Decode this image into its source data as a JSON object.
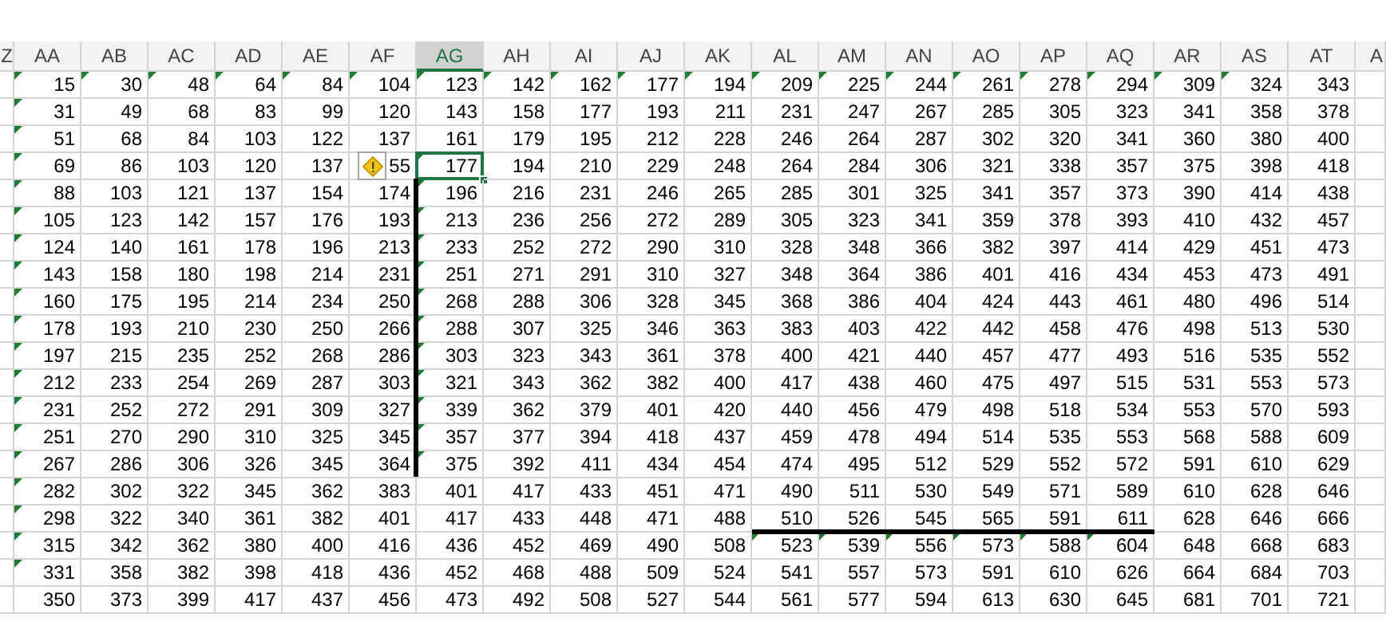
{
  "columns": [
    {
      "label": "Z",
      "selected": false
    },
    {
      "label": "AA",
      "selected": false
    },
    {
      "label": "AB",
      "selected": false
    },
    {
      "label": "AC",
      "selected": false
    },
    {
      "label": "AD",
      "selected": false
    },
    {
      "label": "AE",
      "selected": false
    },
    {
      "label": "AF",
      "selected": false
    },
    {
      "label": "AG",
      "selected": true
    },
    {
      "label": "AH",
      "selected": false
    },
    {
      "label": "AI",
      "selected": false
    },
    {
      "label": "AJ",
      "selected": false
    },
    {
      "label": "AK",
      "selected": false
    },
    {
      "label": "AL",
      "selected": false
    },
    {
      "label": "AM",
      "selected": false
    },
    {
      "label": "AN",
      "selected": false
    },
    {
      "label": "AO",
      "selected": false
    },
    {
      "label": "AP",
      "selected": false
    },
    {
      "label": "AQ",
      "selected": false
    },
    {
      "label": "AR",
      "selected": false
    },
    {
      "label": "AS",
      "selected": false
    },
    {
      "label": "AT",
      "selected": false
    },
    {
      "label": "A",
      "selected": false
    }
  ],
  "error_options_button": {
    "visible": true
  },
  "rows": [
    {
      "selected": false,
      "cells": [
        "15",
        "30",
        "48",
        "64",
        "84",
        "104",
        "123",
        "142",
        "162",
        "177",
        "194",
        "209",
        "225",
        "244",
        "261",
        "278",
        "294",
        "309",
        "324",
        "343"
      ],
      "flags": [
        true,
        true,
        true,
        true,
        true,
        true,
        true,
        true,
        true,
        true,
        true,
        true,
        true,
        true,
        true,
        true,
        true,
        true,
        true,
        false
      ]
    },
    {
      "selected": false,
      "cells": [
        "31",
        "49",
        "68",
        "83",
        "99",
        "120",
        "143",
        "158",
        "177",
        "193",
        "211",
        "231",
        "247",
        "267",
        "285",
        "305",
        "323",
        "341",
        "358",
        "378"
      ],
      "flags": [
        true,
        false,
        false,
        false,
        false,
        false,
        false,
        false,
        false,
        false,
        false,
        false,
        false,
        false,
        false,
        false,
        false,
        false,
        false,
        false
      ]
    },
    {
      "selected": false,
      "cells": [
        "51",
        "68",
        "84",
        "103",
        "122",
        "137",
        "161",
        "179",
        "195",
        "212",
        "228",
        "246",
        "264",
        "287",
        "302",
        "320",
        "341",
        "360",
        "380",
        "400"
      ],
      "flags": [
        true,
        false,
        false,
        false,
        false,
        false,
        false,
        false,
        false,
        false,
        false,
        false,
        false,
        false,
        false,
        false,
        false,
        false,
        false,
        false
      ]
    },
    {
      "selected": true,
      "cells": [
        "69",
        "86",
        "103",
        "120",
        "137",
        "55",
        "177",
        "194",
        "210",
        "229",
        "248",
        "264",
        "284",
        "306",
        "321",
        "338",
        "357",
        "375",
        "398",
        "418"
      ],
      "flags": [
        true,
        false,
        false,
        false,
        false,
        false,
        true,
        false,
        false,
        false,
        false,
        false,
        false,
        false,
        false,
        false,
        false,
        false,
        false,
        false
      ]
    },
    {
      "selected": false,
      "cells": [
        "88",
        "103",
        "121",
        "137",
        "154",
        "174",
        "196",
        "216",
        "231",
        "246",
        "265",
        "285",
        "301",
        "325",
        "341",
        "357",
        "373",
        "390",
        "414",
        "438"
      ],
      "flags": [
        true,
        false,
        false,
        false,
        false,
        false,
        true,
        false,
        false,
        false,
        false,
        false,
        false,
        false,
        false,
        false,
        false,
        false,
        false,
        false
      ]
    },
    {
      "selected": false,
      "cells": [
        "105",
        "123",
        "142",
        "157",
        "176",
        "193",
        "213",
        "236",
        "256",
        "272",
        "289",
        "305",
        "323",
        "341",
        "359",
        "378",
        "393",
        "410",
        "432",
        "457"
      ],
      "flags": [
        true,
        false,
        false,
        false,
        false,
        false,
        true,
        false,
        false,
        false,
        false,
        false,
        false,
        false,
        false,
        false,
        false,
        false,
        false,
        false
      ]
    },
    {
      "selected": false,
      "cells": [
        "124",
        "140",
        "161",
        "178",
        "196",
        "213",
        "233",
        "252",
        "272",
        "290",
        "310",
        "328",
        "348",
        "366",
        "382",
        "397",
        "414",
        "429",
        "451",
        "473"
      ],
      "flags": [
        true,
        false,
        false,
        false,
        false,
        false,
        true,
        false,
        false,
        false,
        false,
        false,
        false,
        false,
        false,
        false,
        false,
        false,
        false,
        false
      ]
    },
    {
      "selected": false,
      "cells": [
        "143",
        "158",
        "180",
        "198",
        "214",
        "231",
        "251",
        "271",
        "291",
        "310",
        "327",
        "348",
        "364",
        "386",
        "401",
        "416",
        "434",
        "453",
        "473",
        "491"
      ],
      "flags": [
        true,
        false,
        false,
        false,
        false,
        false,
        true,
        false,
        false,
        false,
        false,
        false,
        false,
        false,
        false,
        false,
        false,
        false,
        false,
        false
      ]
    },
    {
      "selected": false,
      "cells": [
        "160",
        "175",
        "195",
        "214",
        "234",
        "250",
        "268",
        "288",
        "306",
        "328",
        "345",
        "368",
        "386",
        "404",
        "424",
        "443",
        "461",
        "480",
        "496",
        "514"
      ],
      "flags": [
        true,
        false,
        false,
        false,
        false,
        false,
        true,
        false,
        false,
        false,
        false,
        false,
        false,
        false,
        false,
        false,
        false,
        false,
        false,
        false
      ]
    },
    {
      "selected": false,
      "cells": [
        "178",
        "193",
        "210",
        "230",
        "250",
        "266",
        "288",
        "307",
        "325",
        "346",
        "363",
        "383",
        "403",
        "422",
        "442",
        "458",
        "476",
        "498",
        "513",
        "530"
      ],
      "flags": [
        true,
        false,
        false,
        false,
        false,
        false,
        true,
        false,
        false,
        false,
        false,
        false,
        false,
        false,
        false,
        false,
        false,
        false,
        false,
        false
      ]
    },
    {
      "selected": false,
      "cells": [
        "197",
        "215",
        "235",
        "252",
        "268",
        "286",
        "303",
        "323",
        "343",
        "361",
        "378",
        "400",
        "421",
        "440",
        "457",
        "477",
        "493",
        "516",
        "535",
        "552"
      ],
      "flags": [
        true,
        false,
        false,
        false,
        false,
        false,
        true,
        false,
        false,
        false,
        false,
        false,
        false,
        false,
        false,
        false,
        false,
        false,
        false,
        false
      ]
    },
    {
      "selected": false,
      "cells": [
        "212",
        "233",
        "254",
        "269",
        "287",
        "303",
        "321",
        "343",
        "362",
        "382",
        "400",
        "417",
        "438",
        "460",
        "475",
        "497",
        "515",
        "531",
        "553",
        "573"
      ],
      "flags": [
        true,
        false,
        false,
        false,
        false,
        false,
        true,
        false,
        false,
        false,
        false,
        false,
        false,
        false,
        false,
        false,
        false,
        false,
        false,
        false
      ]
    },
    {
      "selected": false,
      "cells": [
        "231",
        "252",
        "272",
        "291",
        "309",
        "327",
        "339",
        "362",
        "379",
        "401",
        "420",
        "440",
        "456",
        "479",
        "498",
        "518",
        "534",
        "553",
        "570",
        "593"
      ],
      "flags": [
        true,
        false,
        false,
        false,
        false,
        false,
        true,
        false,
        false,
        false,
        false,
        false,
        false,
        false,
        false,
        false,
        false,
        false,
        false,
        false
      ]
    },
    {
      "selected": false,
      "cells": [
        "251",
        "270",
        "290",
        "310",
        "325",
        "345",
        "357",
        "377",
        "394",
        "418",
        "437",
        "459",
        "478",
        "494",
        "514",
        "535",
        "553",
        "568",
        "588",
        "609"
      ],
      "flags": [
        true,
        false,
        false,
        false,
        false,
        false,
        true,
        false,
        false,
        false,
        false,
        false,
        false,
        false,
        false,
        false,
        false,
        false,
        false,
        false
      ]
    },
    {
      "selected": false,
      "cells": [
        "267",
        "286",
        "306",
        "326",
        "345",
        "364",
        "375",
        "392",
        "411",
        "434",
        "454",
        "474",
        "495",
        "512",
        "529",
        "552",
        "572",
        "591",
        "610",
        "629"
      ],
      "flags": [
        true,
        false,
        false,
        false,
        false,
        false,
        true,
        false,
        false,
        false,
        false,
        false,
        false,
        false,
        false,
        false,
        false,
        false,
        false,
        false
      ]
    },
    {
      "selected": false,
      "cells": [
        "282",
        "302",
        "322",
        "345",
        "362",
        "383",
        "401",
        "417",
        "433",
        "451",
        "471",
        "490",
        "511",
        "530",
        "549",
        "571",
        "589",
        "610",
        "628",
        "646"
      ],
      "flags": [
        true,
        false,
        false,
        false,
        false,
        false,
        false,
        false,
        false,
        false,
        false,
        false,
        false,
        false,
        false,
        false,
        false,
        false,
        false,
        false
      ]
    },
    {
      "selected": false,
      "cells": [
        "298",
        "322",
        "340",
        "361",
        "382",
        "401",
        "417",
        "433",
        "448",
        "471",
        "488",
        "510",
        "526",
        "545",
        "565",
        "591",
        "611",
        "628",
        "646",
        "666"
      ],
      "flags": [
        true,
        false,
        false,
        false,
        false,
        false,
        false,
        false,
        false,
        false,
        false,
        false,
        false,
        false,
        false,
        false,
        false,
        false,
        false,
        false
      ]
    },
    {
      "selected": false,
      "cells": [
        "315",
        "342",
        "362",
        "380",
        "400",
        "416",
        "436",
        "452",
        "469",
        "490",
        "508",
        "523",
        "539",
        "556",
        "573",
        "588",
        "604",
        "648",
        "668",
        "683"
      ],
      "flags": [
        true,
        false,
        false,
        false,
        false,
        false,
        false,
        false,
        false,
        false,
        false,
        true,
        true,
        true,
        true,
        true,
        true,
        false,
        false,
        false
      ]
    },
    {
      "selected": false,
      "cells": [
        "331",
        "358",
        "382",
        "398",
        "418",
        "436",
        "452",
        "468",
        "488",
        "509",
        "524",
        "541",
        "557",
        "573",
        "591",
        "610",
        "626",
        "664",
        "684",
        "703"
      ],
      "flags": [
        true,
        false,
        false,
        false,
        false,
        false,
        false,
        false,
        false,
        false,
        false,
        false,
        false,
        false,
        false,
        false,
        false,
        false,
        false,
        false
      ]
    },
    {
      "selected": false,
      "cells": [
        "350",
        "373",
        "399",
        "417",
        "437",
        "456",
        "473",
        "492",
        "508",
        "527",
        "544",
        "561",
        "577",
        "594",
        "613",
        "630",
        "645",
        "681",
        "701",
        "721"
      ],
      "flags": [
        false,
        false,
        false,
        false,
        false,
        false,
        false,
        false,
        false,
        false,
        false,
        false,
        false,
        false,
        false,
        false,
        false,
        false,
        false,
        false
      ]
    }
  ]
}
